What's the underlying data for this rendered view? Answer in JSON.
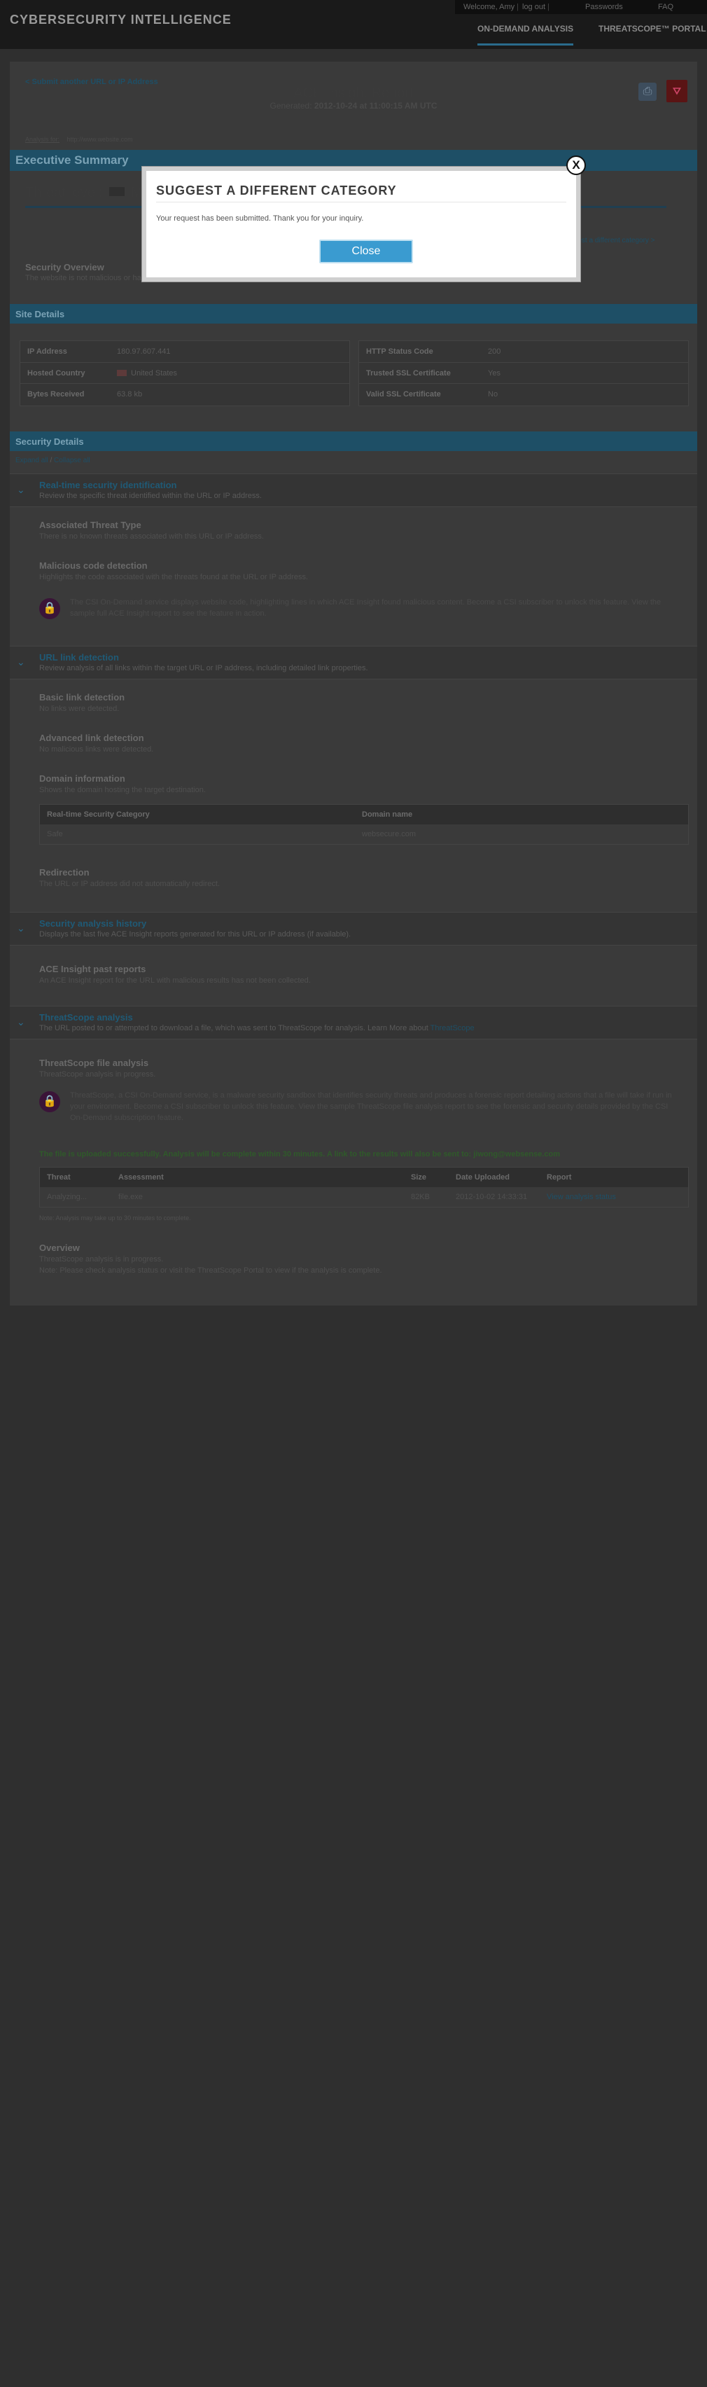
{
  "header": {
    "brand": "CYBERSECURITY INTELLIGENCE",
    "welcome": "Welcome, Amy",
    "logout": "log out",
    "passwords": "Passwords",
    "faq": "FAQ",
    "nav": [
      "ON-DEMAND ANALYSIS",
      "THREATSCOPE™ PORTAL"
    ]
  },
  "report": {
    "back_link": "< Submit another URL or IP Address",
    "title": "ACE Insight Report",
    "generated_label": "Generated:",
    "generated_value": "2012-10-24 at 11:00:15 AM UTC",
    "analysis_for_label": "Analysis for:",
    "analysis_for_value": "http://www.website.com"
  },
  "executive": {
    "heading": "Executive Summary",
    "threat_level_label": "Threat level:",
    "threat_level_value": "M",
    "suggest_link": "Suggest a different category >",
    "security_overview_title": "Security Overview",
    "security_overview_text": "The website is not malicious or harmful to visitors."
  },
  "site_details": {
    "heading": "Site Details",
    "left": [
      {
        "label": "IP Address",
        "value": "180.97.607.441"
      },
      {
        "label": "Hosted Country",
        "value": "United States"
      },
      {
        "label": "Bytes Received",
        "value": "63.8 kb"
      }
    ],
    "right": [
      {
        "label": "HTTP Status Code",
        "value": "200"
      },
      {
        "label": "Trusted SSL Certificate",
        "value": "Yes"
      },
      {
        "label": "Valid SSL Certificate",
        "value": "No"
      }
    ]
  },
  "security_details": {
    "heading": "Security Details",
    "expand_all": "Expand all",
    "separator": " / ",
    "collapse_all": "Collapse all"
  },
  "sections": {
    "realtime": {
      "title": "Real-time security identification",
      "desc": "Review the specific threat identified within the URL or IP address.",
      "associated_title": "Associated Threat Type",
      "associated_text": "There is no known threats associated with this URL or IP address.",
      "malicious_title": "Malicious code detection",
      "malicious_text": "Highlights the code associated with the threats found at the URL or IP address.",
      "lock_text": "The CSI On-Demand service displays website code, highlighting lines in which ACE Insight found malicious content. Become a CSI subscriber to unlock this feature. View the sample full ACE Insight report to see the feature in action."
    },
    "url_link": {
      "title": "URL link detection",
      "desc": "Review analysis of all links within the target URL or IP address, including detailed link properties.",
      "basic_title": "Basic link detection",
      "basic_text": "No links were detected.",
      "advanced_title": "Advanced link detection",
      "advanced_text": "No malicious links were detected.",
      "domain_title": "Domain information",
      "domain_text": "Shows the domain hosting the target destination.",
      "domain_table": {
        "headers": [
          "Real-time Security Category",
          "Domain name"
        ],
        "rows": [
          [
            "Safe",
            "websecure.com"
          ]
        ]
      },
      "redirection_title": "Redirection",
      "redirection_text": "The URL or IP address did not automatically redirect."
    },
    "history": {
      "title": "Security analysis history",
      "desc": "Displays the last five ACE Insight reports generated for this URL or IP address (if available).",
      "past_title": "ACE Insight past reports",
      "past_text": "An ACE Insight report for the URL with malicious results has not been collected."
    },
    "threatscope": {
      "title": "ThreatScope analysis",
      "desc_prefix": "The URL posted to or attempted to download a file, which was sent to ThreatScope for analysis. Learn More about",
      "desc_link": "ThreatScope",
      "file_title": "ThreatScope file analysis",
      "file_text": "ThreatScope analysis in progress.",
      "lock_text": "ThreatScope, a CSI On-Demand service, is a malware security sandbox that identifies security threats and produces a forensic report detailing actions that a file will take if run in your environment. Become a CSI subscriber to unlock this feature. View the sample ThreatScope file analysis report to see the forensic and security details provided by the CSI On-Demand subscription feature.",
      "success_text": "The file is uploaded successfully. Analysis will be complete within 30 minutes. A link to the results will also be sent to: jiwong@websense.com",
      "table": {
        "headers": [
          "Threat",
          "Assessment",
          "Size",
          "Date Uploaded",
          "Report"
        ],
        "rows": [
          [
            "Analyzing...",
            "file.exe",
            "82KB",
            "2012-10-02 14:33:31",
            "View analysis status"
          ]
        ]
      },
      "note": "Note: Analysis may take up to 30 minutes to complete.",
      "overview_title": "Overview",
      "overview_text": "ThreatScope analysis is in progress.",
      "overview_note": "Note: Please check analysis status or visit the ThreatScope Portal to view if the analysis is complete."
    }
  },
  "modal": {
    "title": "SUGGEST A DIFFERENT CATEGORY",
    "message": "Your request has been submitted. Thank you for your inquiry.",
    "close_label": "Close",
    "close_x": "X"
  },
  "colors": {
    "overlay": "#2f2f2f",
    "accent": "#3a9bd0",
    "section_bar": "#1e4f66"
  },
  "icons": [
    "printer-icon",
    "pdf-icon",
    "lock-icon",
    "chevron-down-icon",
    "flag-icon",
    "close-icon"
  ]
}
